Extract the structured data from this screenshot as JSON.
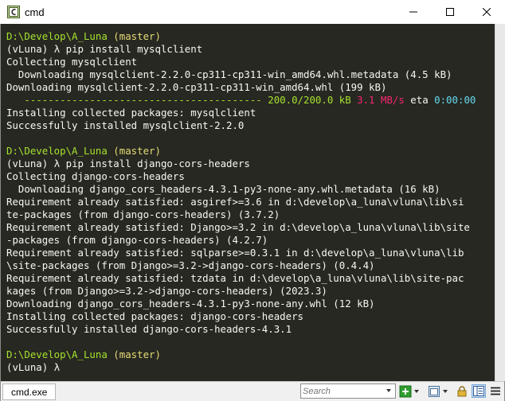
{
  "window": {
    "title": "cmd"
  },
  "status_bar": {
    "tab_label": "cmd.exe",
    "search_placeholder": "Search"
  },
  "colors": {
    "terminal_bg": "#272822",
    "text": "#f8f8f2",
    "path": "#a6e22e",
    "branch": "#e6db74",
    "progress": "#a6e22e",
    "rate": "#f92672",
    "eta": "#66d9ef"
  },
  "console": {
    "lines": [
      [
        [
          "path",
          "D:\\Develop\\A_Luna"
        ],
        [
          "text",
          " "
        ],
        [
          "branch",
          "(master)"
        ]
      ],
      [
        [
          "text",
          "(vLuna) "
        ],
        [
          "lambda",
          "λ"
        ],
        [
          "text",
          " pip install mysqlclient"
        ]
      ],
      [
        [
          "text",
          "Collecting mysqlclient"
        ]
      ],
      [
        [
          "text",
          "  Downloading mysqlclient-2.2.0-cp311-cp311-win_amd64.whl.metadata (4.5 kB)"
        ]
      ],
      [
        [
          "text",
          "Downloading mysqlclient-2.2.0-cp311-cp311-win_amd64.whl (199 kB)"
        ]
      ],
      [
        [
          "bar",
          "   ---------------------------------------- 200.0/200.0 kB"
        ],
        [
          "text",
          " "
        ],
        [
          "rate",
          "3.1 MB/s"
        ],
        [
          "text",
          " eta "
        ],
        [
          "eta",
          "0:00:00"
        ]
      ],
      [
        [
          "text",
          "Installing collected packages: mysqlclient"
        ]
      ],
      [
        [
          "text",
          "Successfully installed mysqlclient-2.2.0"
        ]
      ],
      [],
      [
        [
          "path",
          "D:\\Develop\\A_Luna"
        ],
        [
          "text",
          " "
        ],
        [
          "branch",
          "(master)"
        ]
      ],
      [
        [
          "text",
          "(vLuna) "
        ],
        [
          "lambda",
          "λ"
        ],
        [
          "text",
          " pip install django-cors-headers"
        ]
      ],
      [
        [
          "text",
          "Collecting django-cors-headers"
        ]
      ],
      [
        [
          "text",
          "  Downloading django_cors_headers-4.3.1-py3-none-any.whl.metadata (16 kB)"
        ]
      ],
      [
        [
          "text",
          "Requirement already satisfied: asgiref>=3.6 in d:\\develop\\a_luna\\vluna\\lib\\si"
        ]
      ],
      [
        [
          "text",
          "te-packages (from django-cors-headers) (3.7.2)"
        ]
      ],
      [
        [
          "text",
          "Requirement already satisfied: Django>=3.2 in d:\\develop\\a_luna\\vluna\\lib\\site"
        ]
      ],
      [
        [
          "text",
          "-packages (from django-cors-headers) (4.2.7)"
        ]
      ],
      [
        [
          "text",
          "Requirement already satisfied: sqlparse>=0.3.1 in d:\\develop\\a_luna\\vluna\\lib"
        ]
      ],
      [
        [
          "text",
          "\\site-packages (from Django>=3.2->django-cors-headers) (0.4.4)"
        ]
      ],
      [
        [
          "text",
          "Requirement already satisfied: tzdata in d:\\develop\\a_luna\\vluna\\lib\\site-pac"
        ]
      ],
      [
        [
          "text",
          "kages (from Django>=3.2->django-cors-headers) (2023.3)"
        ]
      ],
      [
        [
          "text",
          "Downloading django_cors_headers-4.3.1-py3-none-any.whl (12 kB)"
        ]
      ],
      [
        [
          "text",
          "Installing collected packages: django-cors-headers"
        ]
      ],
      [
        [
          "text",
          "Successfully installed django-cors-headers-4.3.1"
        ]
      ],
      [],
      [
        [
          "path",
          "D:\\Develop\\A_Luna"
        ],
        [
          "text",
          " "
        ],
        [
          "branch",
          "(master)"
        ]
      ],
      [
        [
          "text",
          "(vLuna) "
        ],
        [
          "lambda",
          "λ"
        ]
      ]
    ]
  }
}
